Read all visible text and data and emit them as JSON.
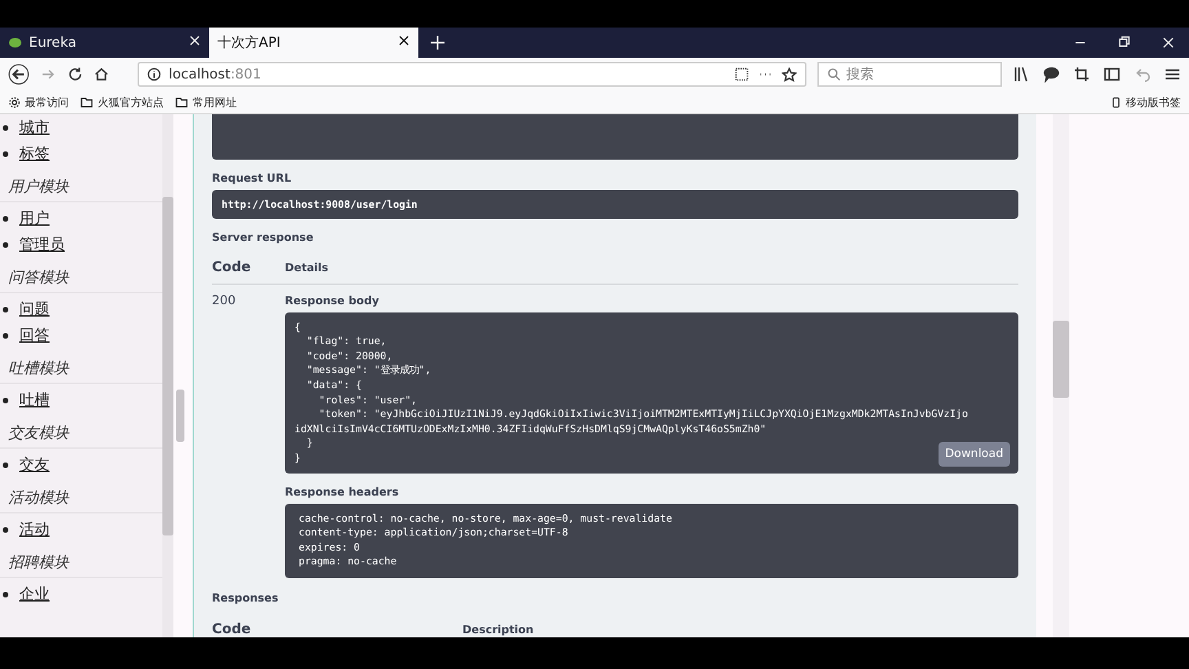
{
  "browser": {
    "tabs": [
      {
        "title": "Eureka",
        "selected": false
      },
      {
        "title": "十次方API",
        "selected": true
      }
    ],
    "url": {
      "host": "localhost",
      "port": ":801"
    },
    "search": {
      "placeholder": "搜索"
    },
    "bookmarks": [
      {
        "label": "最常访问",
        "kind": "gear"
      },
      {
        "label": "火狐官方站点",
        "kind": "folder"
      },
      {
        "label": "常用网址",
        "kind": "folder"
      }
    ],
    "mobile_bookmarks": "移动版书签"
  },
  "sidebar": {
    "groups": [
      {
        "items": [
          "城市",
          "标签"
        ]
      },
      {
        "title": "用户模块",
        "items": [
          "用户",
          "管理员"
        ]
      },
      {
        "title": "问答模块",
        "items": [
          "问题",
          "回答"
        ]
      },
      {
        "title": "吐槽模块",
        "items": [
          "吐槽"
        ]
      },
      {
        "title": "交友模块",
        "items": [
          "交友"
        ]
      },
      {
        "title": "活动模块",
        "items": [
          "活动"
        ]
      },
      {
        "title": "招聘模块",
        "items": [
          "企业"
        ]
      }
    ]
  },
  "main": {
    "request_url_label": "Request URL",
    "request_url": "http://localhost:9008/user/login",
    "server_response_label": "Server response",
    "columns": [
      "Code",
      "Details"
    ],
    "status_code": "200",
    "response_body_label": "Response body",
    "response_body": [
      "{",
      "  \"flag\": true,",
      "  \"code\": 20000,",
      "  \"message\": \"登录成功\",",
      "  \"data\": {",
      "    \"roles\": \"user\",",
      "    \"token\": \"eyJhbGciOiJIUzI1NiJ9.eyJqdGkiOiIxIiwic3ViIjoiMTM2MTExMTIyMjIiLCJpYXQiOjE1MzgxMDk2MTAsInJvbGVzIjo",
      "idXNlciIsImV4cCI6MTUzODExMzIxMH0.34ZFIidqWuFfSzHsDMlqS9jCMwAQplyKsT46oS5mZh0\"",
      "  }",
      "}"
    ],
    "download": "Download",
    "response_headers_label": "Response headers",
    "response_headers": [
      "cache-control: no-cache, no-store, max-age=0, must-revalidate",
      "content-type: application/json;charset=UTF-8",
      "expires: 0",
      "pragma: no-cache"
    ],
    "responses_label": "Responses",
    "responses_columns": [
      "Code",
      "Description"
    ]
  }
}
